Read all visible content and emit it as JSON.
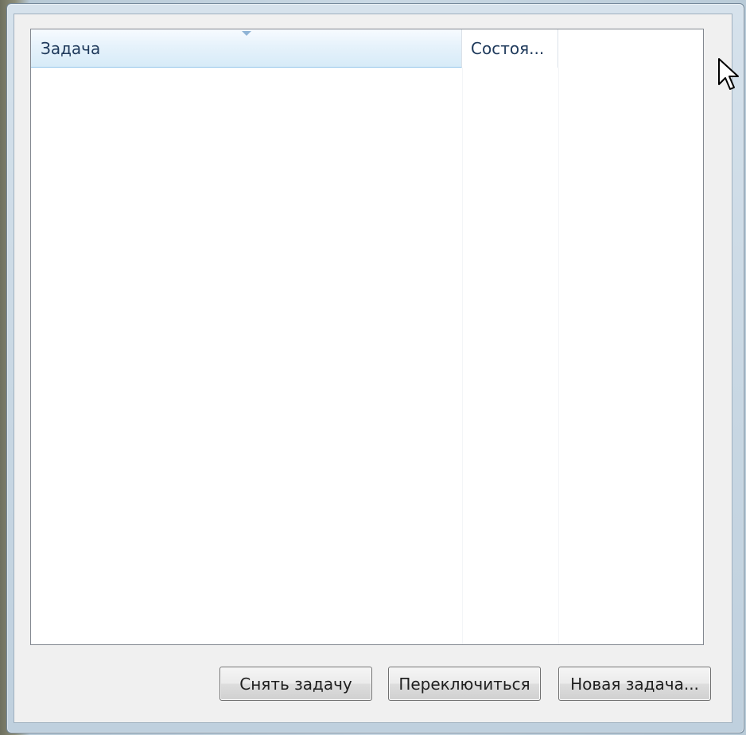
{
  "list": {
    "columns": [
      {
        "label": "Задача"
      },
      {
        "label": "Состоя..."
      },
      {
        "label": ""
      }
    ],
    "rows": []
  },
  "buttons": {
    "end_task_label": "Снять задачу",
    "switch_label": "Переключиться",
    "new_task_label": "Новая задача..."
  },
  "icons": {
    "sort": "sort-down-icon",
    "cursor": "mouse-pointer-icon"
  },
  "colors": {
    "selected_header": "#d7ebf8",
    "header_text": "#1e395b",
    "button_face": "#e6e6e6"
  }
}
